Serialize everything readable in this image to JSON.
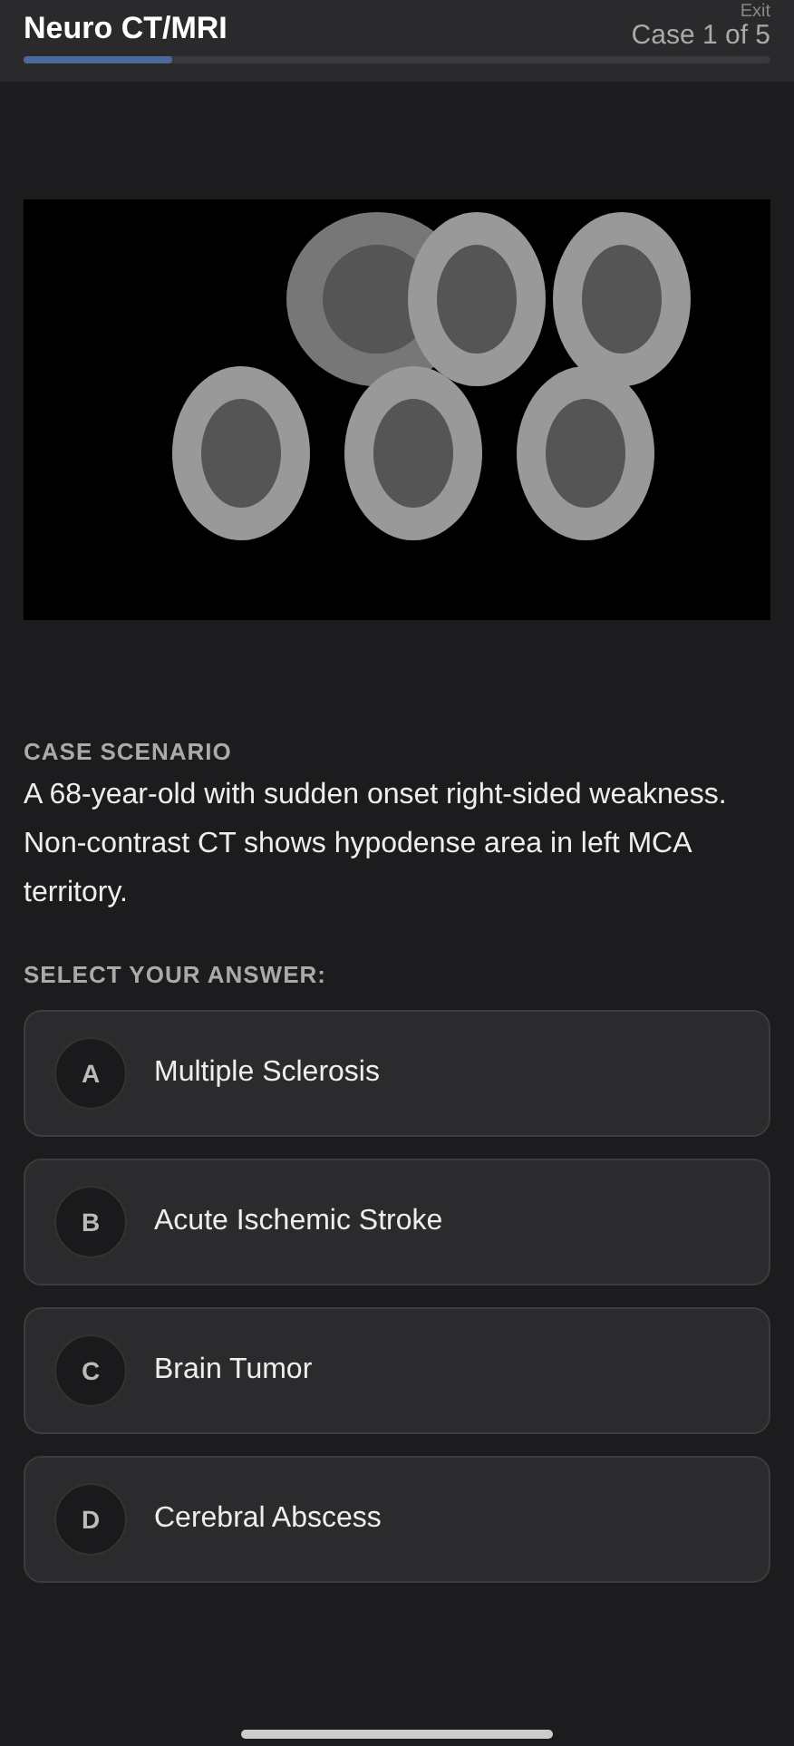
{
  "header": {
    "title": "Neuro CT/MRI",
    "exit": "Exit",
    "case_counter": "Case 1 of 5",
    "progress": {
      "level": 0.2
    }
  },
  "scenario": {
    "label": "CASE SCENARIO",
    "text": "A 68-year-old with sudden onset right-sided weakness. Non-contrast CT shows hypodense area in left MCA territory."
  },
  "answers": {
    "label": "SELECT YOUR ANSWER:",
    "options": [
      {
        "letter": "A",
        "text": "Multiple Sclerosis",
        "selected": false
      },
      {
        "letter": "B",
        "text": "Acute Ischemic Stroke",
        "selected": false
      },
      {
        "letter": "C",
        "text": "Brain Tumor",
        "selected": false
      },
      {
        "letter": "D",
        "text": "Cerebral Abscess",
        "selected": false
      }
    ]
  }
}
